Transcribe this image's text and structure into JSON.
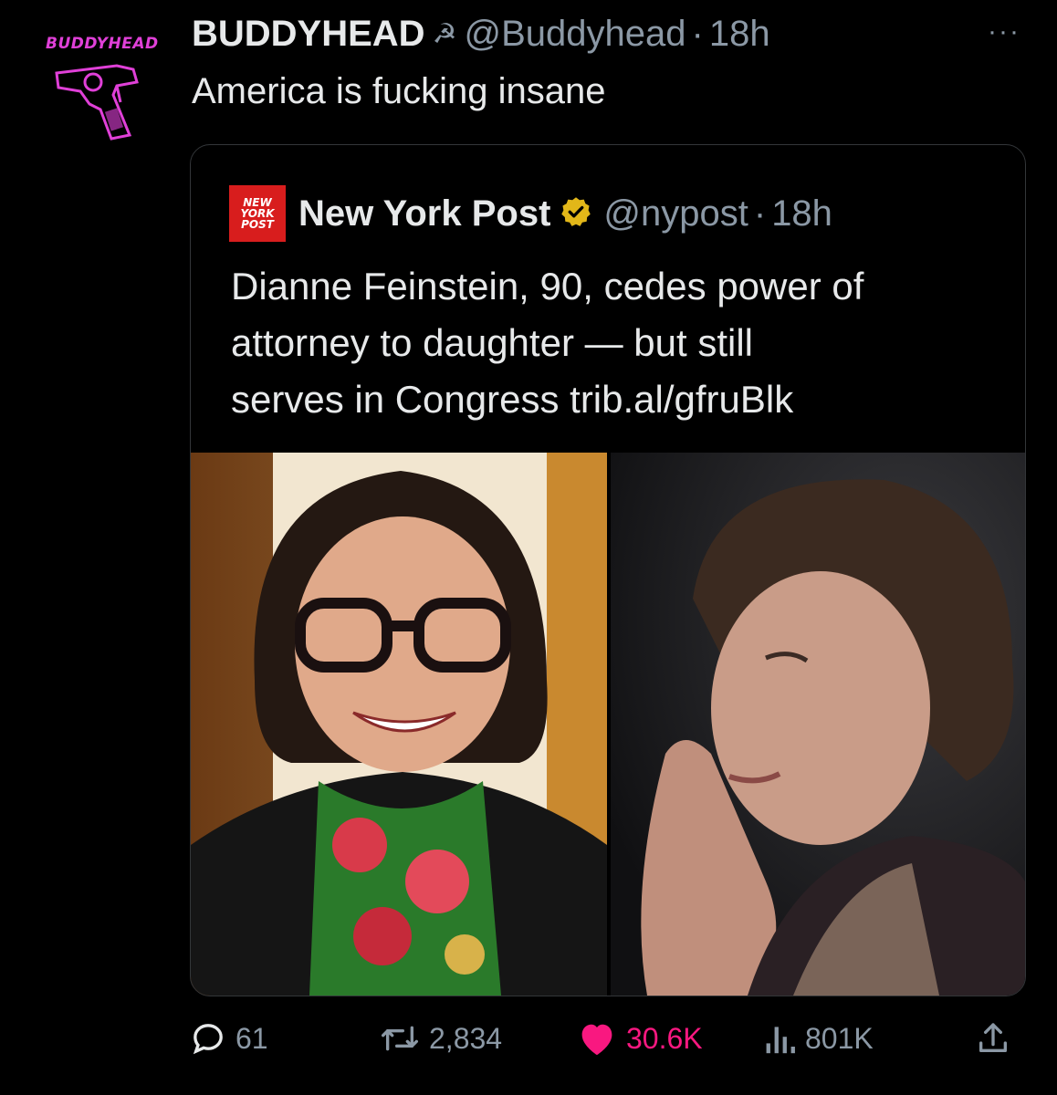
{
  "tweet": {
    "avatar_text": "BUDDYHEAD",
    "display_name": "BUDDYHEAD",
    "name_emoji": "☭",
    "handle": "@Buddyhead",
    "separator": "·",
    "time": "18h",
    "more_icon": "···",
    "text": "America is fucking insane"
  },
  "quote": {
    "logo_lines": [
      "NEW",
      "YORK",
      "POST"
    ],
    "display_name": "New York Post",
    "verified_icon": "verified-badge-icon",
    "verified_color": "#e2b719",
    "handle": "@nypost",
    "separator": "·",
    "time": "18h",
    "text_lines": [
      "Dianne Feinstein, 90, cedes power of",
      "attorney to daughter — but still",
      "serves in Congress trib.al/gfruBlk"
    ]
  },
  "actions": {
    "reply": {
      "icon": "reply-icon",
      "count": "61"
    },
    "retweet": {
      "icon": "retweet-icon",
      "count": "2,834"
    },
    "like": {
      "icon": "heart-icon",
      "count": "30.6K",
      "color": "#f91880"
    },
    "views": {
      "icon": "views-icon",
      "count": "801K"
    },
    "share": {
      "icon": "share-icon"
    }
  },
  "colors": {
    "background": "#000000",
    "text": "#e7e9ea",
    "muted": "#8b98a5",
    "avatar_accent": "#e040d8",
    "nyp_red": "#d81d1d"
  }
}
